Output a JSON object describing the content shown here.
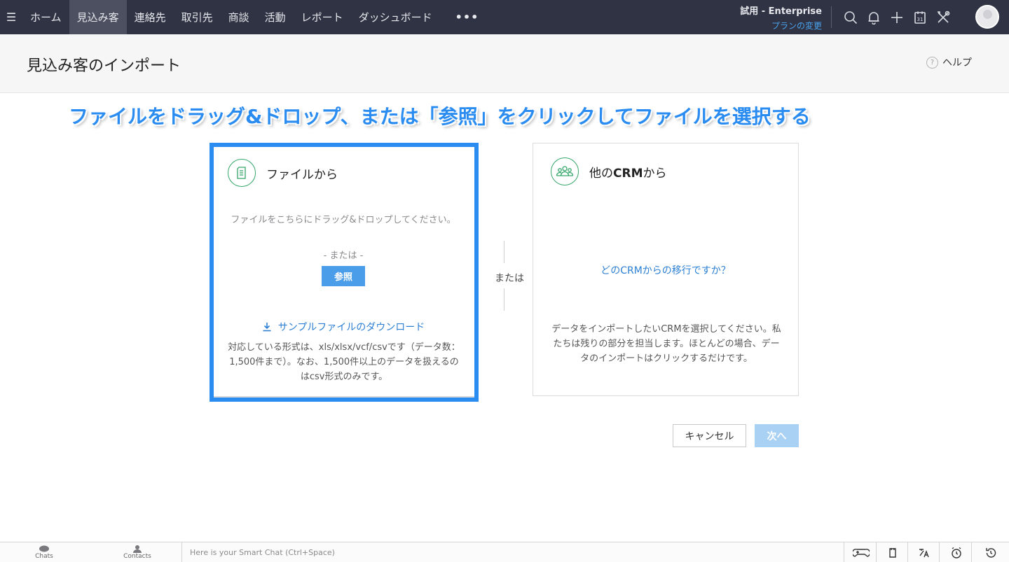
{
  "topbar": {
    "menu_icon": "hamburger-icon",
    "nav": [
      {
        "label": "ホーム",
        "active": false
      },
      {
        "label": "見込み客",
        "active": true
      },
      {
        "label": "連絡先",
        "active": false
      },
      {
        "label": "取引先",
        "active": false
      },
      {
        "label": "商談",
        "active": false
      },
      {
        "label": "活動",
        "active": false
      },
      {
        "label": "レポート",
        "active": false
      },
      {
        "label": "ダッシュボード",
        "active": false
      }
    ],
    "more_label": "•••",
    "plan_title": "試用 - Enterprise",
    "plan_link": "プランの変更",
    "icons": [
      "search-icon",
      "bell-icon",
      "plus-icon",
      "calendar-icon",
      "tools-icon"
    ],
    "calendar_day": "31"
  },
  "header": {
    "title": "見込み客のインポート",
    "help_glyph": "?",
    "help_label": "ヘルプ"
  },
  "annotation": {
    "text": "ファイルをドラッグ&ドロップ、または「参照」をクリックしてファイルを選択する"
  },
  "from_file": {
    "title": "ファイルから",
    "icon": "document-icon",
    "drop_text": "ファイルをこちらにドラッグ&ドロップしてください。",
    "or_text": "-  または  -",
    "browse_label": "参照",
    "sample_link": "サンプルファイルのダウンロード",
    "formats_text": "対応している形式は、xls/xlsx/vcf/csvです（データ数：1,500件まで）。なお、1,500件以上のデータを扱えるのはcsv形式のみです。"
  },
  "or_label": "または",
  "from_crm": {
    "title_prefix": "他の",
    "title_bold": "CRM",
    "title_suffix": "から",
    "icon": "people-group-icon",
    "link": "どのCRMからの移行ですか？",
    "description": "データをインポートしたいCRMを選択してください。私たちは残りの部分を担当します。ほとんどの場合、データのインポートはクリックするだけです。"
  },
  "buttons": {
    "cancel": "キャンセル",
    "next": "次へ"
  },
  "colors": {
    "topbar": "#2f3343",
    "accent_blue": "#2a8cf0",
    "link_blue": "#2c7fd3",
    "icon_green": "#35a66a",
    "next_disabled": "#a8d1f4"
  },
  "bottombar": {
    "chats": "Chats",
    "contacts": "Contacts",
    "smartchat_placeholder": "Here is your Smart Chat (Ctrl+Space)",
    "right_icons": [
      "gamepad-icon",
      "notes-icon",
      "translate-icon",
      "alarm-icon",
      "history-icon"
    ]
  }
}
